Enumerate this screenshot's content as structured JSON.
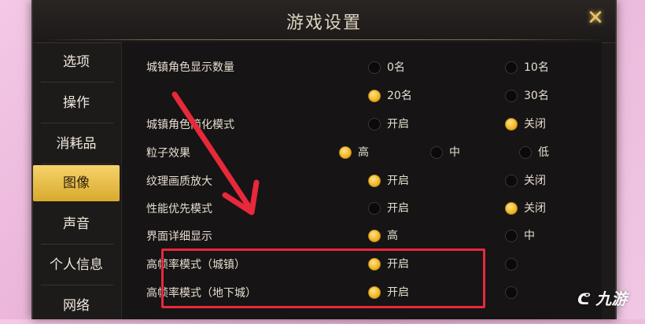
{
  "title": "游戏设置",
  "sidebar": {
    "items": [
      {
        "label": "选项",
        "active": false
      },
      {
        "label": "操作",
        "active": false
      },
      {
        "label": "消耗品",
        "active": false
      },
      {
        "label": "图像",
        "active": true
      },
      {
        "label": "声音",
        "active": false
      },
      {
        "label": "个人信息",
        "active": false
      },
      {
        "label": "网络",
        "active": false
      }
    ]
  },
  "settings": {
    "town_count": {
      "label": "城镇角色显示数量",
      "options": [
        "0名",
        "10名",
        "20名",
        "30名"
      ],
      "selected": "20名"
    },
    "town_simplify": {
      "label": "城镇角色简化模式",
      "options": [
        "开启",
        "关闭"
      ],
      "selected": "关闭"
    },
    "particles": {
      "label": "粒子效果",
      "options": [
        "高",
        "中",
        "低"
      ],
      "selected": "高"
    },
    "texture_upscale": {
      "label": "纹理画质放大",
      "options": [
        "开启",
        "关闭"
      ],
      "selected": "开启"
    },
    "performance_mode": {
      "label": "性能优先模式",
      "options": [
        "开启",
        "关闭"
      ],
      "selected": "关闭"
    },
    "ui_detail": {
      "label": "界面详细显示",
      "options": [
        "高",
        "中"
      ],
      "selected": "高"
    },
    "hfr_town": {
      "label": "高帧率模式（城镇）",
      "options": [
        "开启"
      ],
      "selected": "开启"
    },
    "hfr_dungeon": {
      "label": "高帧率模式（地下城）",
      "options": [
        "开启"
      ],
      "selected": "开启"
    }
  },
  "annotation": {
    "color": "#e8283b"
  },
  "watermark": {
    "text": "九游"
  },
  "colors": {
    "accent": "#f2b625",
    "background": "#1d1a1a",
    "page_bg": "#f0c7e4"
  }
}
